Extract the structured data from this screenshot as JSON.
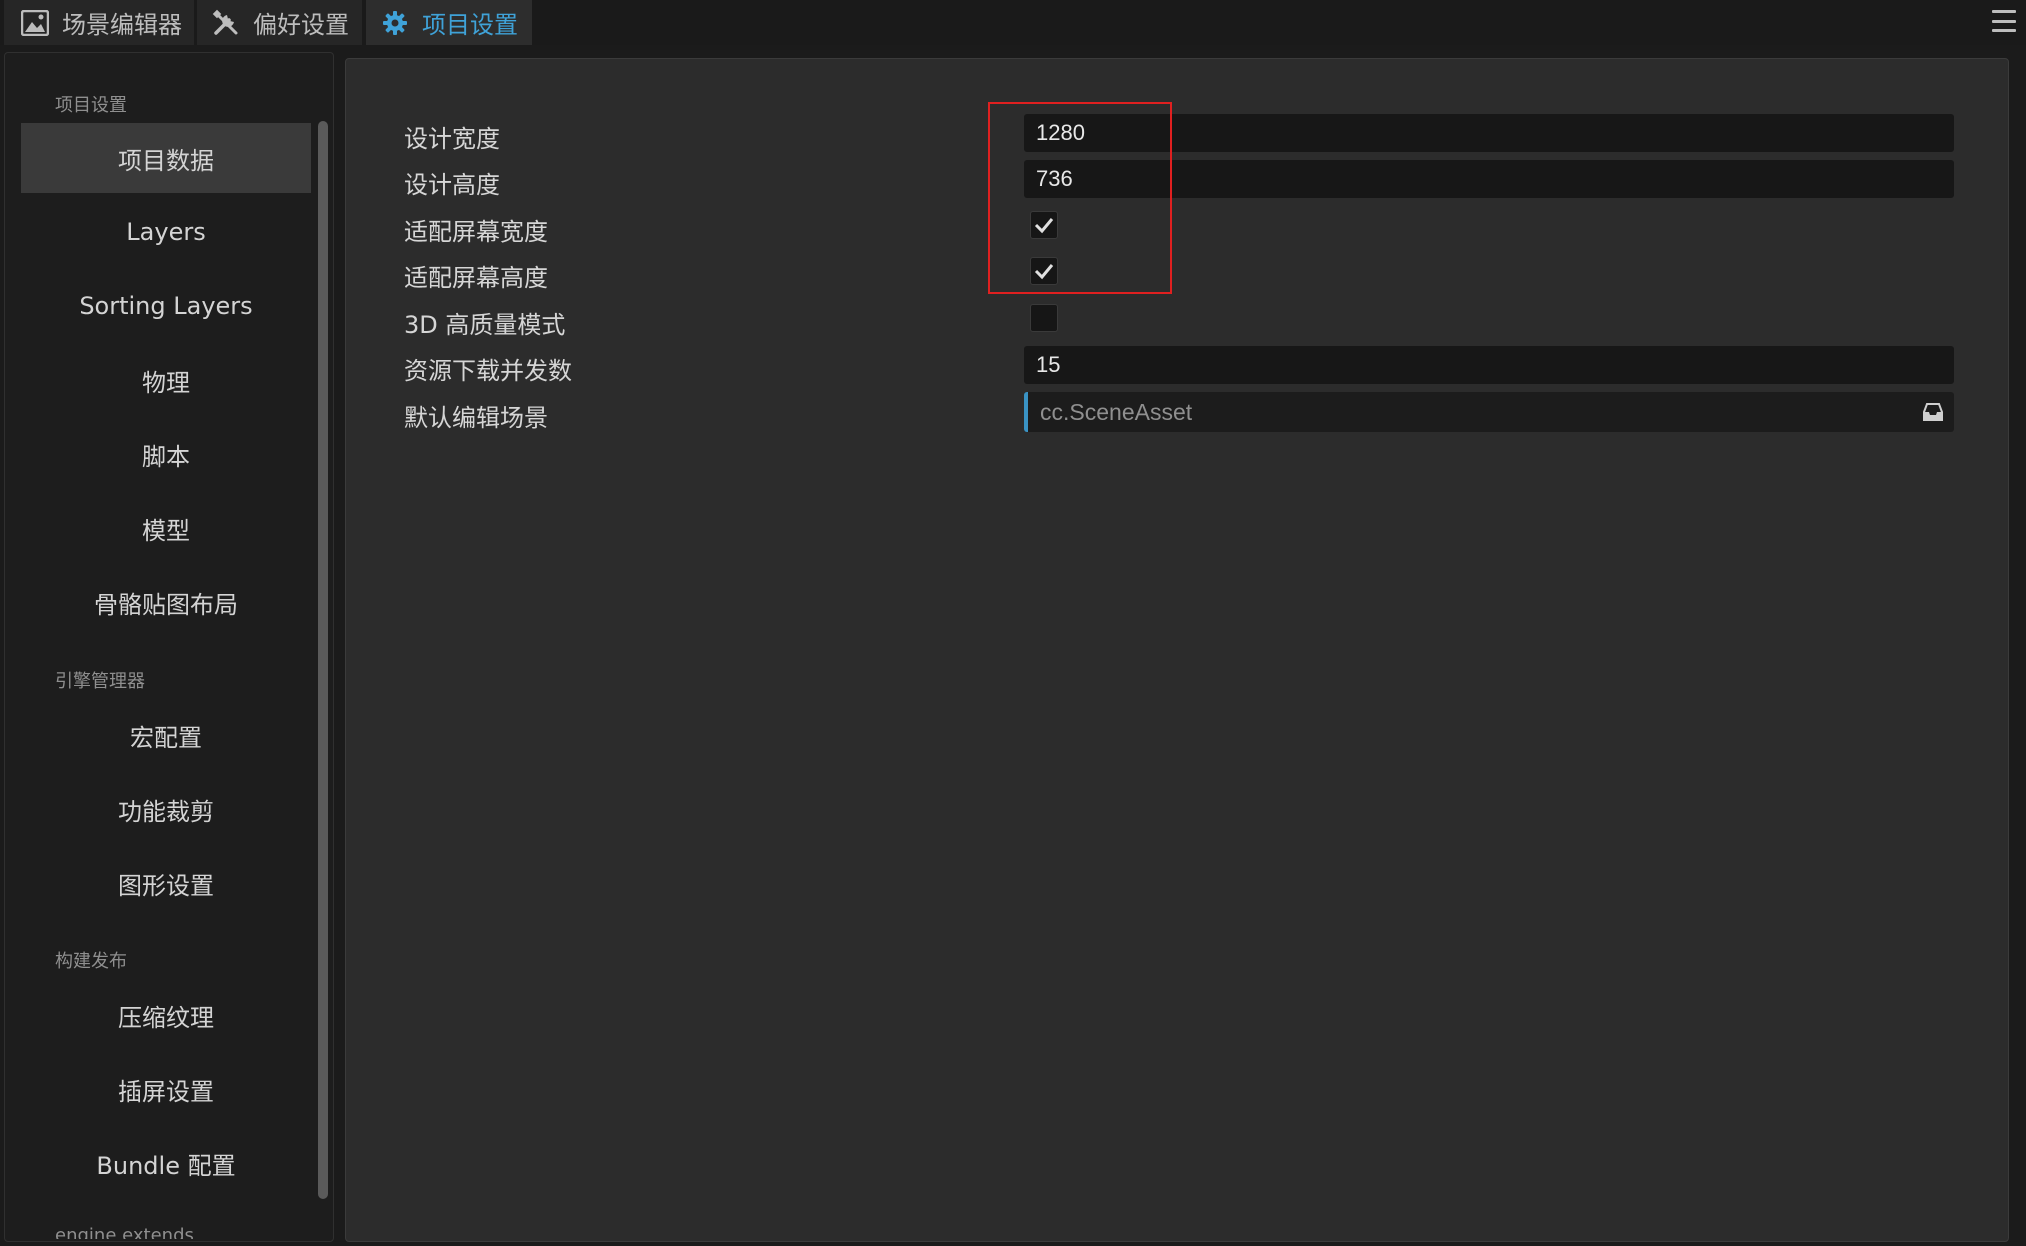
{
  "tabs": [
    {
      "label": "场景编辑器",
      "icon": "scene-image-icon",
      "active": false
    },
    {
      "label": "偏好设置",
      "icon": "tools-icon",
      "active": false
    },
    {
      "label": "项目设置",
      "icon": "gear-icon",
      "active": true
    }
  ],
  "sidebar": {
    "groups": [
      {
        "header": "项目设置",
        "items": [
          "项目数据",
          "Layers",
          "Sorting Layers",
          "物理",
          "脚本",
          "模型",
          "骨骼贴图布局"
        ]
      },
      {
        "header": "引擎管理器",
        "items": [
          "宏配置",
          "功能裁剪",
          "图形设置"
        ]
      },
      {
        "header": "构建发布",
        "items": [
          "压缩纹理",
          "插屏设置",
          "Bundle 配置"
        ]
      },
      {
        "header": "engine extends",
        "items": []
      }
    ],
    "selected_item": "项目数据"
  },
  "properties": {
    "design_width": {
      "label": "设计宽度",
      "value": "1280"
    },
    "design_height": {
      "label": "设计高度",
      "value": "736"
    },
    "fit_width": {
      "label": "适配屏幕宽度",
      "checked": true
    },
    "fit_height": {
      "label": "适配屏幕高度",
      "checked": true
    },
    "hq_3d": {
      "label": "3D 高质量模式",
      "checked": false
    },
    "download_concurrency": {
      "label": "资源下载并发数",
      "value": "15"
    },
    "default_scene": {
      "label": "默认编辑场景",
      "value": "cc.SceneAsset"
    }
  },
  "colors": {
    "accent": "#3fa2d8",
    "highlight": "#e02020",
    "background": "#2c2c2c"
  }
}
